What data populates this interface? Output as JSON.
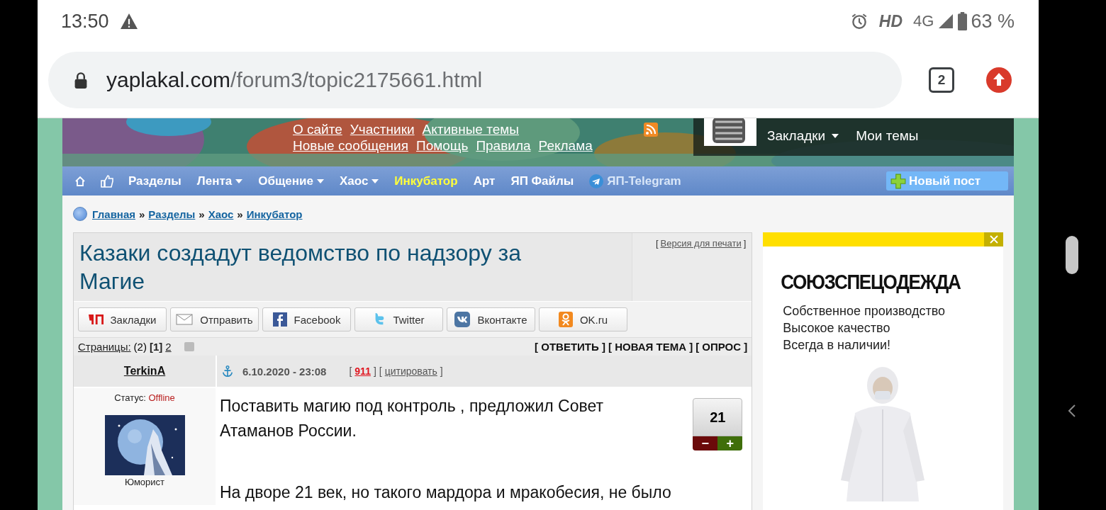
{
  "status_bar": {
    "time": "13:50",
    "network": "HD",
    "signal": "4G",
    "battery": "63 %"
  },
  "browser": {
    "url_host": "yaplakal.com",
    "url_path": "/forum3/topic2175661.html",
    "tab_count": "2"
  },
  "header": {
    "link_rows": [
      [
        "О сайте",
        "Участники",
        "Активные темы"
      ],
      [
        "Новые сообщения",
        "Помощь",
        "Правила",
        "Реклама"
      ]
    ],
    "user_menu": [
      {
        "label": "Закладки",
        "dropdown": true
      },
      {
        "label": "Мои темы",
        "dropdown": false
      }
    ]
  },
  "nav": {
    "items": [
      {
        "label": "Разделы",
        "dropdown": false,
        "highlight": false,
        "kind": "link"
      },
      {
        "label": "Лента",
        "dropdown": true,
        "highlight": false,
        "kind": "link"
      },
      {
        "label": "Общение",
        "dropdown": true,
        "highlight": false,
        "kind": "link"
      },
      {
        "label": "Хаос",
        "dropdown": true,
        "highlight": false,
        "kind": "link"
      },
      {
        "label": "Инкубатор",
        "dropdown": false,
        "highlight": true,
        "kind": "link"
      },
      {
        "label": "Арт",
        "dropdown": false,
        "highlight": false,
        "kind": "link"
      },
      {
        "label": "ЯП Файлы",
        "dropdown": false,
        "highlight": false,
        "kind": "link"
      },
      {
        "label": "ЯП-Telegram",
        "dropdown": false,
        "highlight": false,
        "kind": "telegram"
      }
    ],
    "new_post": "Новый пост"
  },
  "breadcrumbs": {
    "items": [
      "Главная",
      "Разделы",
      "Хаос",
      "Инкубатор"
    ],
    "separator": "»"
  },
  "topic": {
    "title": "Казаки создадут ведомство по надзору за Магие",
    "print_link": {
      "before": "[",
      "label": "Версия для печати",
      "after": "]"
    },
    "share_buttons": [
      {
        "label": "Закладки",
        "kind": "yap"
      },
      {
        "label": "Отправить",
        "kind": "mail"
      },
      {
        "label": "Facebook",
        "kind": "facebook"
      },
      {
        "label": "Twitter",
        "kind": "twitter"
      },
      {
        "label": "Вконтакте",
        "kind": "vk"
      },
      {
        "label": "OK.ru",
        "kind": "ok"
      }
    ]
  },
  "pages": {
    "label": "Страницы:",
    "count": "(2)",
    "items": [
      {
        "label": "[1]",
        "selected": true
      },
      {
        "label": "2",
        "selected": false
      }
    ],
    "actions": [
      "[ ОТВЕТИТЬ ]",
      "[ НОВАЯ ТЕМА ]",
      "[ ОПРОС ]"
    ]
  },
  "post": {
    "author": "TerkinA",
    "date": "6.10.2020 - 23:08",
    "number": {
      "before": "[",
      "label": "911",
      "after": "]"
    },
    "quote": {
      "before": "[",
      "label": "цитировать",
      "after": "]"
    },
    "status_label": "Статус:",
    "status": "Offline",
    "rank": "Юморист",
    "rating": "21",
    "minus": "−",
    "plus": "+",
    "body": [
      "Поставить магию под контроль , предложил Совет Атаманов России.",
      "На дворе 21 век, но такого мардора и мракобесия, не было"
    ]
  },
  "ad": {
    "heading": "СОЮЗСПЕЦОДЕЖДА",
    "lines": [
      "Собственное производство",
      "Высокое качество",
      "Всегда в наличии!"
    ]
  }
}
